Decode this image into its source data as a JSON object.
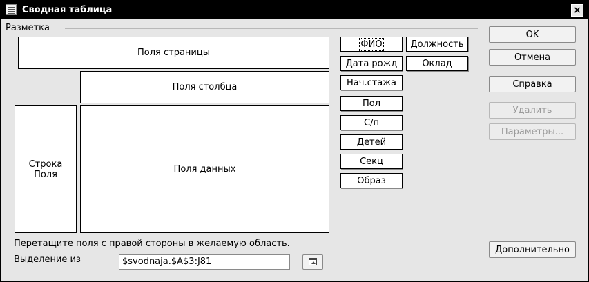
{
  "window": {
    "title": "Сводная таблица",
    "title_icon": "pivot-table-icon",
    "close_icon": "close-icon"
  },
  "layout": {
    "group_label": "Разметка",
    "page_fields": "Поля страницы",
    "column_fields": "Поля столбца",
    "row_fields_line1": "Строка",
    "row_fields_line2": "Поля",
    "data_fields": "Поля данных"
  },
  "fields": [
    {
      "label": "ФИО"
    },
    {
      "label": "Должность"
    },
    {
      "label": "Дата рожд"
    },
    {
      "label": "Оклад"
    },
    {
      "label": "Нач.стажа"
    },
    {
      "label": "Пол"
    },
    {
      "label": "С/п"
    },
    {
      "label": "Детей"
    },
    {
      "label": "Секц"
    },
    {
      "label": "Образ"
    }
  ],
  "buttons": {
    "ok": "OK",
    "cancel": "Отмена",
    "help": "Справка",
    "delete": "Удалить",
    "options": "Параметры...",
    "more": "Дополнительно"
  },
  "footer": {
    "hint": "Перетащите поля с правой стороны в желаемую область.",
    "selection_label": "Выделение из",
    "selection_value": "$svodnaja.$A$3:J81",
    "shrink_icon": "shrink-dialog-icon"
  },
  "colors": {
    "titlebar": "#000000",
    "dialog_bg": "#e6e6e6"
  }
}
